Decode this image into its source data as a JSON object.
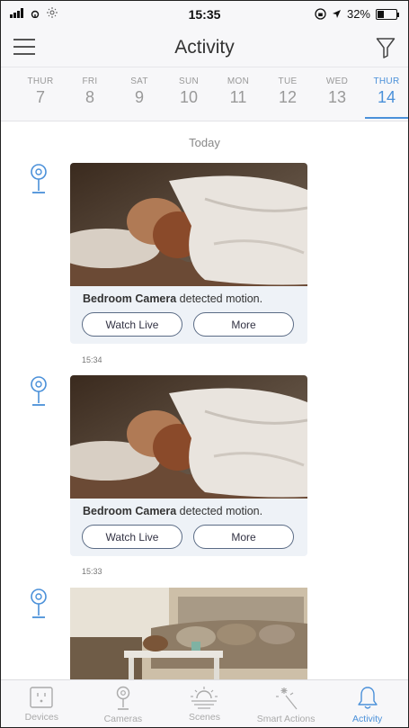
{
  "status_bar": {
    "time": "15:35",
    "battery": "32%"
  },
  "header": {
    "title": "Activity"
  },
  "dates": [
    {
      "dow": "THUR",
      "num": "7"
    },
    {
      "dow": "FRI",
      "num": "8"
    },
    {
      "dow": "SAT",
      "num": "9"
    },
    {
      "dow": "SUN",
      "num": "10"
    },
    {
      "dow": "MON",
      "num": "11"
    },
    {
      "dow": "TUE",
      "num": "12"
    },
    {
      "dow": "WED",
      "num": "13"
    },
    {
      "dow": "THUR",
      "num": "14",
      "active": true
    }
  ],
  "feed": {
    "section_label": "Today",
    "events": [
      {
        "camera": "Bedroom Camera",
        "message": " detected motion.",
        "watch_label": "Watch Live",
        "more_label": "More",
        "time": "15:34"
      },
      {
        "camera": "Bedroom Camera",
        "message": " detected motion.",
        "watch_label": "Watch Live",
        "more_label": "More",
        "time": "15:33"
      }
    ]
  },
  "tabs": [
    {
      "label": "Devices",
      "icon": "outlet-icon"
    },
    {
      "label": "Cameras",
      "icon": "camera-icon"
    },
    {
      "label": "Scenes",
      "icon": "sunrise-icon"
    },
    {
      "label": "Smart Actions",
      "icon": "sparkle-icon"
    },
    {
      "label": "Activity",
      "icon": "bell-icon",
      "active": true
    }
  ],
  "colors": {
    "accent": "#4a90d9",
    "card_bg": "#eef2f7"
  }
}
